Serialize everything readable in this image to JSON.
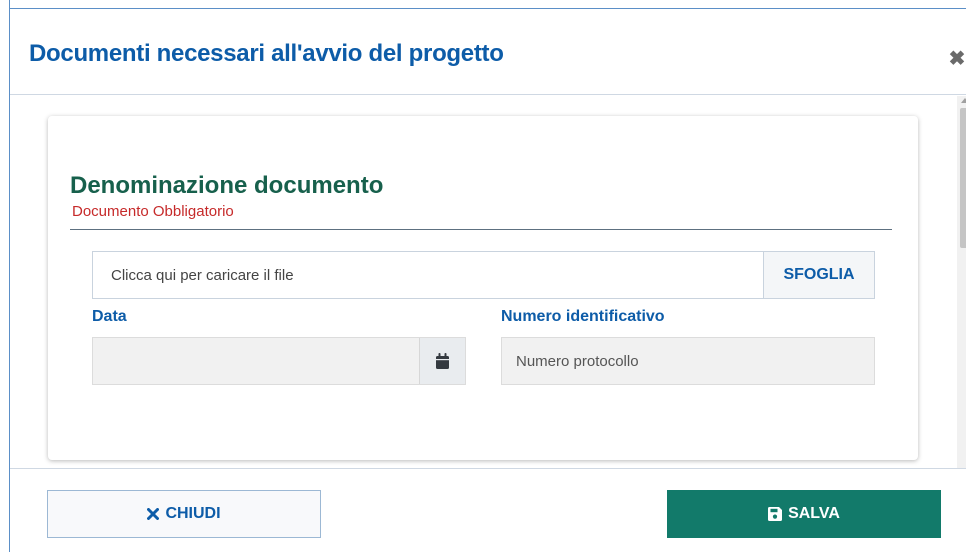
{
  "modal": {
    "title": "Documenti necessari all'avvio del progetto"
  },
  "card": {
    "title": "Denominazione documento",
    "subtitle": "Documento Obbligatorio"
  },
  "upload": {
    "placeholder": "Clicca qui per caricare il file",
    "browse_label": "SFOGLIA"
  },
  "fields": {
    "date_label": "Data",
    "date_value": "",
    "id_label": "Numero identificativo",
    "id_placeholder": "Numero protocollo"
  },
  "footer": {
    "close_label": "CHIUDI",
    "save_label": "SALVA"
  },
  "icons": {
    "close": "close-icon",
    "calendar": "calendar-icon",
    "times": "times-icon",
    "save": "save-icon"
  },
  "colors": {
    "primary_blue": "#0d5ca8",
    "title_green": "#17604c",
    "required_red": "#c62a2a",
    "save_green": "#127a6a"
  }
}
